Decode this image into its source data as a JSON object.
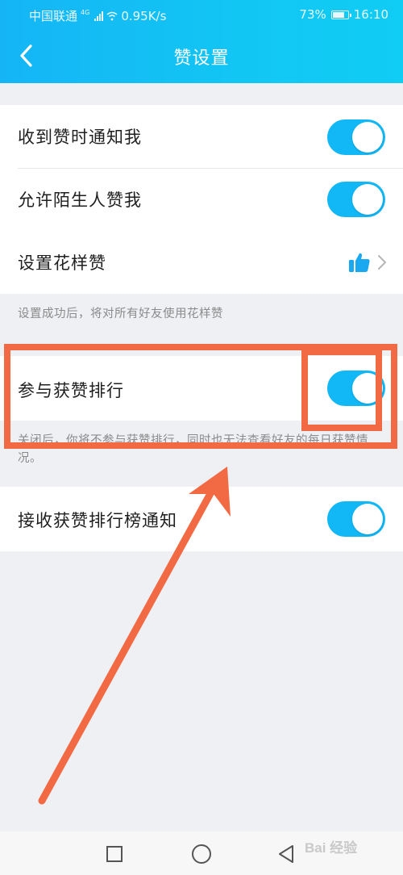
{
  "status_bar": {
    "carrier": "中国联通",
    "network": "4G",
    "speed": "0.95K/s",
    "battery": "73%",
    "time": "16:10"
  },
  "header": {
    "title": "赞设置",
    "back_icon": "chevron-left-icon"
  },
  "settings": {
    "notify_on_like": {
      "label": "收到赞时通知我",
      "enabled": true
    },
    "allow_strangers": {
      "label": "允许陌生人赞我",
      "enabled": true
    },
    "fancy_like": {
      "label": "设置花样赞",
      "icon": "thumbs-up-icon"
    },
    "fancy_like_note": "设置成功后，将对所有好友使用花样赞",
    "join_ranking": {
      "label": "参与获赞排行",
      "enabled": true
    },
    "join_ranking_note": "关闭后，你将不参与获赞排行，同时也无法查看好友的每日获赞情况。",
    "ranking_notify": {
      "label": "接收获赞排行榜通知",
      "enabled": true
    }
  },
  "bottom_nav": {
    "items": [
      "recent-apps-icon",
      "home-icon",
      "back-icon"
    ]
  },
  "watermark": "Bai 经验",
  "colors": {
    "accent": "#12b7f5",
    "annotation": "#f26a43",
    "background": "#eff0f4"
  }
}
